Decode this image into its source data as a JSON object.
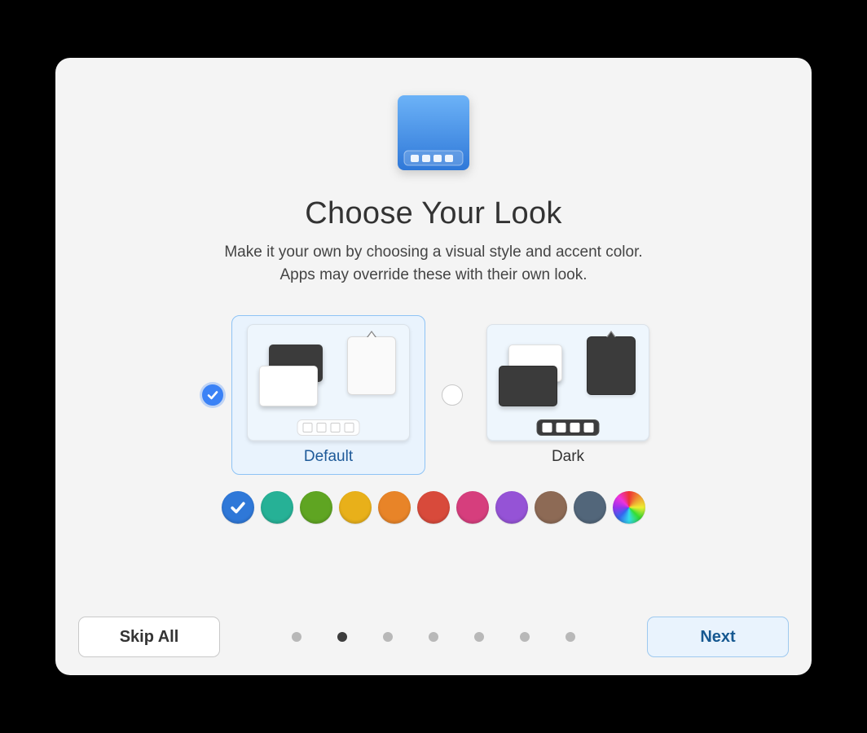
{
  "title": "Choose Your Look",
  "subtitle_line1": "Make it your own by choosing a visual style and accent color.",
  "subtitle_line2": "Apps may override these with their own look.",
  "style_options": [
    {
      "id": "default",
      "label": "Default",
      "selected": true
    },
    {
      "id": "dark",
      "label": "Dark",
      "selected": false
    }
  ],
  "accent_colors": [
    {
      "name": "blueberry",
      "hex": "#2f78d8",
      "selected": true
    },
    {
      "name": "mint",
      "hex": "#26b196",
      "selected": false
    },
    {
      "name": "lime",
      "hex": "#5fa522",
      "selected": false
    },
    {
      "name": "banana",
      "hex": "#e8b01a",
      "selected": false
    },
    {
      "name": "orange",
      "hex": "#e88428",
      "selected": false
    },
    {
      "name": "strawberry",
      "hex": "#d84a3b",
      "selected": false
    },
    {
      "name": "bubblegum",
      "hex": "#d63e7d",
      "selected": false
    },
    {
      "name": "grape",
      "hex": "#9553d6",
      "selected": false
    },
    {
      "name": "cocoa",
      "hex": "#8d6a55",
      "selected": false
    },
    {
      "name": "slate",
      "hex": "#52667a",
      "selected": false
    },
    {
      "name": "automatic",
      "hex": "rainbow",
      "selected": false
    }
  ],
  "pagination": {
    "total": 7,
    "current_index": 1
  },
  "buttons": {
    "skip_label": "Skip All",
    "next_label": "Next"
  }
}
